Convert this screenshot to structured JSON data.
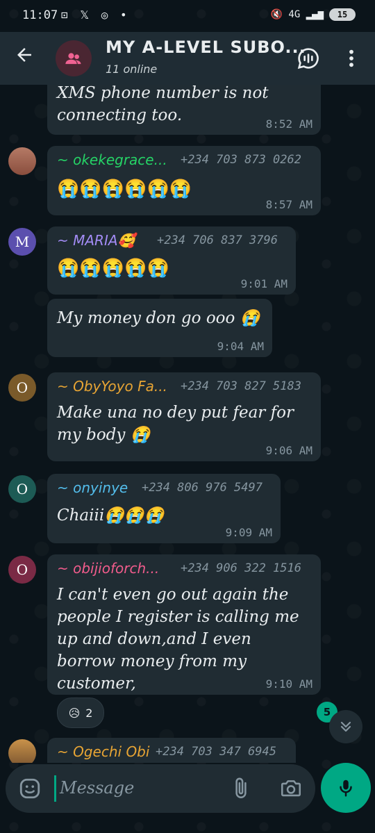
{
  "status_bar": {
    "time": "11:07",
    "icons": "⊡ 𝕏 ◎ •",
    "network": "🔇 4G ▂▄▆",
    "battery": "15"
  },
  "header": {
    "title": "MY A-LEVEL SUBO...",
    "subtitle": "11 online"
  },
  "messages": [
    {
      "text": "XMS phone number is not connecting too.",
      "time": "8:52 AM"
    },
    {
      "sender": "~ okekegrace...",
      "sender_color": "#25d366",
      "phone": "+234 703 873 0262",
      "text": "😭😭😭😭😭😭",
      "time": "8:57 AM"
    },
    {
      "avatar": "M",
      "avatar_color": "#5b4fae",
      "sender": "~ MARIA🥰",
      "sender_color": "#a38cf6",
      "phone": "+234 706 837 3796",
      "text": "😭😭😭😭😭",
      "time": "9:01 AM"
    },
    {
      "text": "My money don go ooo 😭",
      "time": "9:04 AM"
    },
    {
      "avatar": "O",
      "avatar_color": "#7a5a2a",
      "sender": "~ ObyYoyo Fa...",
      "sender_color": "#e8a534",
      "phone": "+234 703 827 5183",
      "text": "Make una no dey put fear for my body 😭",
      "time": "9:06 AM"
    },
    {
      "avatar": "O",
      "avatar_color": "#1d5b55",
      "sender": "~ onyinye",
      "sender_color": "#53bdeb",
      "phone": "+234 806 976 5497",
      "text": "Chaiii😭😭😭",
      "time": "9:09 AM"
    },
    {
      "avatar": "O",
      "avatar_color": "#7a2a45",
      "sender": "~ obijioforch...",
      "sender_color": "#f15c8c",
      "phone": "+234 906 322 1516",
      "text": "I can't even go out again the people I register is calling me up and down,and I even borrow money from my customer,",
      "time": "9:10 AM"
    },
    {
      "sender": "~ Ogechi Obi",
      "sender_color": "#e8a534",
      "phone": "+234 703 347 6945"
    }
  ],
  "reaction": {
    "emoji": "😥",
    "count": "2"
  },
  "unread_count": "5",
  "composer": {
    "placeholder": "Message"
  }
}
